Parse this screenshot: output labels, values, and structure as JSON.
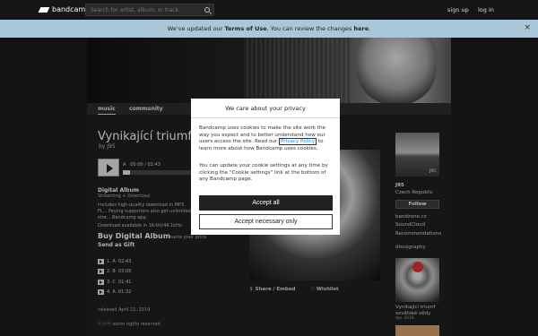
{
  "header": {
    "logo_text": "bandcamp",
    "search_placeholder": "Search for artist, album, or track",
    "signup": "sign up",
    "login": "log in"
  },
  "banner": {
    "text_pre": "We've updated our",
    "terms": "Terms of Use",
    "text_mid": ". You can review the changes",
    "here": "here",
    "text_end": ".",
    "close": "×"
  },
  "tabs": [
    "music",
    "community"
  ],
  "album": {
    "title": "Vynikající triumf s",
    "by": "by J95",
    "now_playing_track": "A",
    "time": "00:00 / 02:43",
    "progress": 0.0,
    "format_title": "Digital Album",
    "format_sub": "Streaming + Download",
    "description": "Includes high-quality download in MP3, FL... Paying supporters also get unlimited stre... Bandcamp app.",
    "availability": "Download available in 16-bit/44.1kHz.",
    "buy": "Buy Digital Album",
    "buy_name_price": "name your price",
    "gift": "Send as Gift",
    "tracks": [
      {
        "num": "1.",
        "name": "A",
        "time": "02:43"
      },
      {
        "num": "2.",
        "name": "B",
        "time": "03:05"
      },
      {
        "num": "3.",
        "name": "C",
        "time": "01:41"
      },
      {
        "num": "4.",
        "name": "A",
        "time": "01:32"
      }
    ],
    "released": "released April 22, 2019",
    "rights": "some rights reserved",
    "share": "Share / Embed",
    "wishlist": "Wishlist"
  },
  "sidebar": {
    "image_tag": "J95",
    "artist": "J95",
    "location": "Czech Republic",
    "follow": "Follow",
    "links": [
      "bandzone.cz",
      "SoundCloud",
      "Recommendations"
    ],
    "discography": "discography",
    "disc_title": "Vynikající triumf sovětské vědy",
    "disc_date": "Apr 2019"
  },
  "cookie": {
    "heading": "We care about your privacy",
    "para1_pre": "Bandcamp uses cookies to make the site work the way you expect and to better understand how our users access the site. Read our",
    "privacy_link": "Privacy Policy",
    "para1_post": "to learn more about how Bandcamp uses cookies.",
    "para2": "You can update your cookie settings at any time by clicking the \"Cookie settings\" link at the bottom of any Bandcamp page.",
    "accept_all": "Accept all",
    "accept_necessary": "Accept necessary only"
  }
}
